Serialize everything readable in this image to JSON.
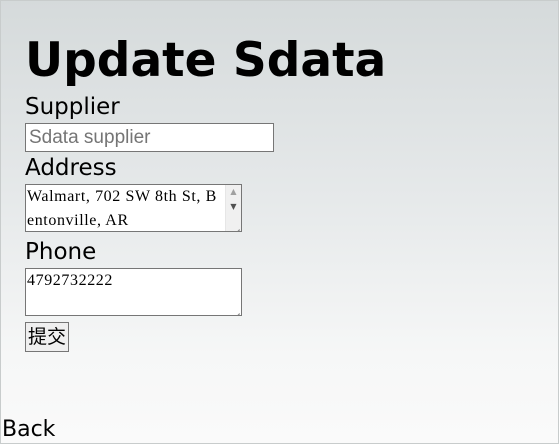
{
  "page": {
    "title": "Update Sdata"
  },
  "form": {
    "supplier": {
      "label": "Supplier",
      "placeholder": "Sdata supplier",
      "value": ""
    },
    "address": {
      "label": "Address",
      "value": "Walmart, 702 SW 8th St, Bentonville, AR"
    },
    "phone": {
      "label": "Phone",
      "value": "4792732222"
    },
    "submit_label": "提交"
  },
  "footer": {
    "back_label": "Back"
  },
  "icons": {
    "scroll_up": "chevron-up-icon",
    "scroll_down": "chevron-down-icon",
    "resize": "resize-grip-icon"
  }
}
